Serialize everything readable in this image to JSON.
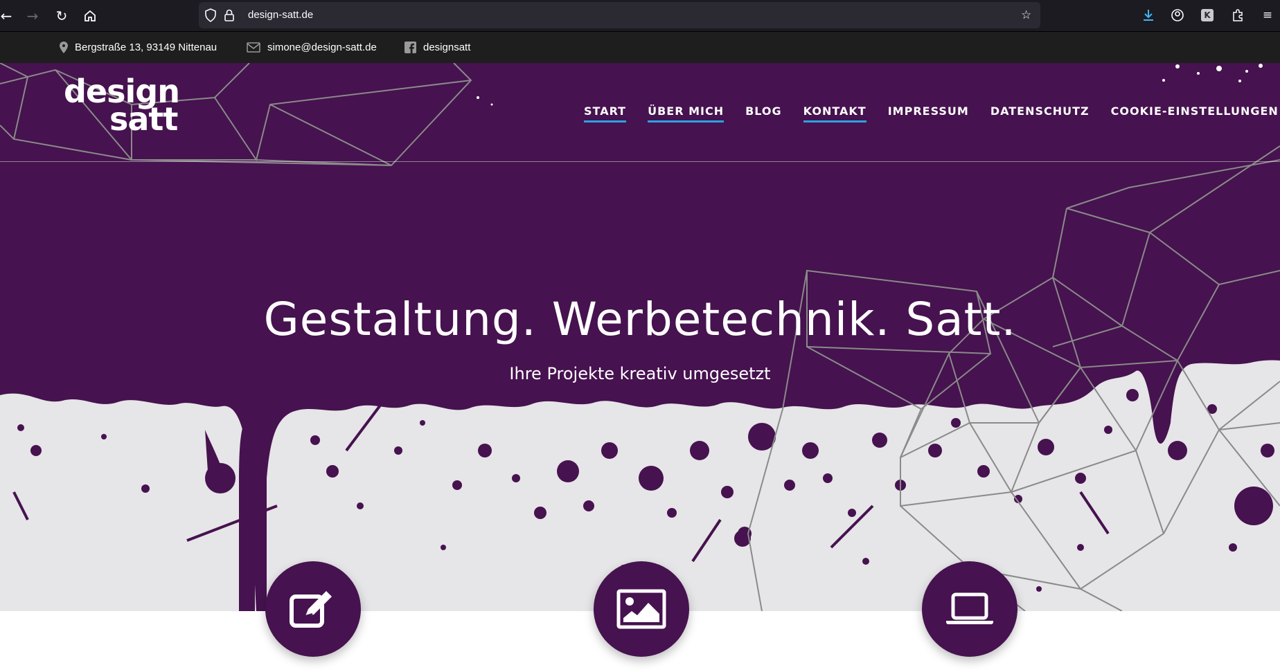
{
  "browser": {
    "url": "design-satt.de",
    "back_icon": "arrow-left-icon",
    "forward_icon": "arrow-right-icon",
    "reload_icon": "reload-icon",
    "home_icon": "home-icon"
  },
  "infobar": {
    "address": "Bergstraße 13, 93149 Nittenau",
    "email": "simone@design-satt.de",
    "facebook": "designsatt"
  },
  "logo": {
    "line1": "design",
    "line2": "satt"
  },
  "nav": {
    "items": [
      {
        "label": "START",
        "active": true
      },
      {
        "label": "ÜBER MICH",
        "active": true
      },
      {
        "label": "BLOG",
        "active": false
      },
      {
        "label": "KONTAKT",
        "active": true
      },
      {
        "label": "IMPRESSUM",
        "active": false
      },
      {
        "label": "DATENSCHUTZ",
        "active": false
      },
      {
        "label": "COOKIE-EINSTELLUNGEN",
        "active": false
      }
    ]
  },
  "hero": {
    "headline": "Gestaltung. Werbetechnik. Satt.",
    "subheadline": "Ihre Projekte kreativ umgesetzt"
  },
  "services": [
    {
      "icon": "edit-pen-icon"
    },
    {
      "icon": "image-icon"
    },
    {
      "icon": "laptop-icon"
    }
  ],
  "colors": {
    "brand_purple": "#46124f",
    "accent_blue": "#2aa3e3",
    "splash_grey": "#e6e5e7"
  }
}
